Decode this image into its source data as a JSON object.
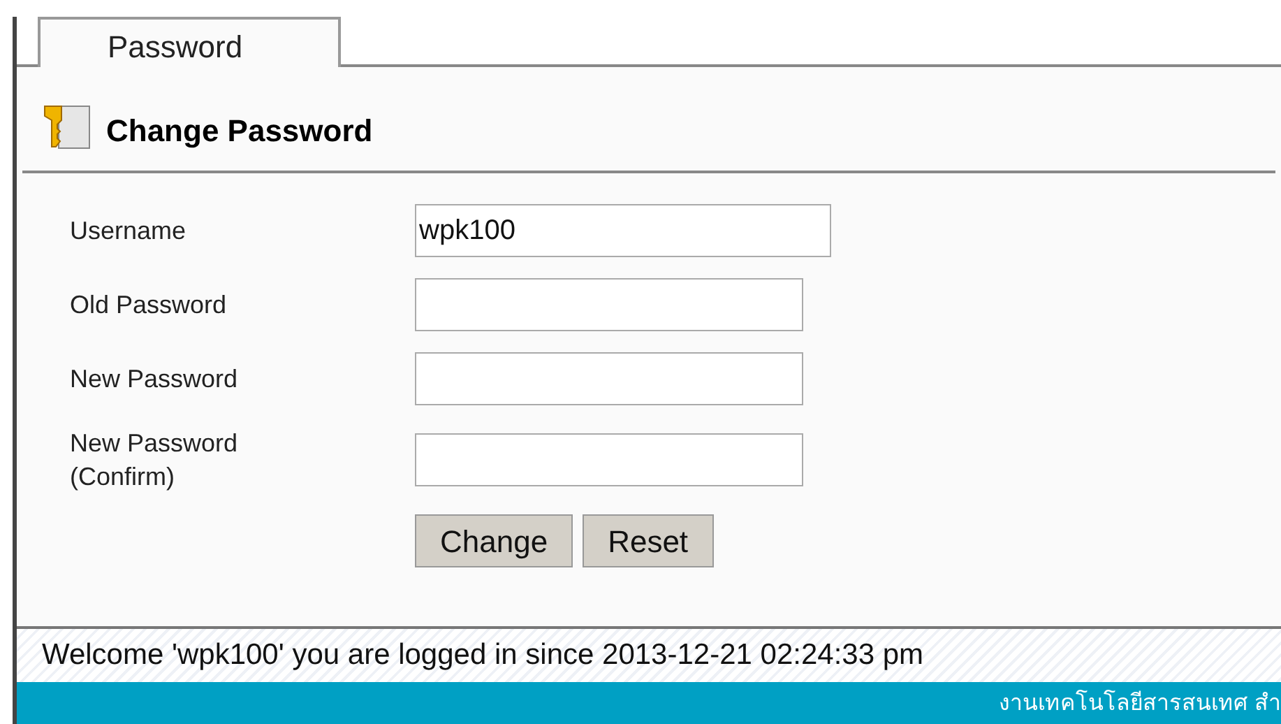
{
  "tabs": [
    {
      "label": "Password",
      "selected": true
    }
  ],
  "heading": "Change Password",
  "form": {
    "fields": [
      {
        "label": "Username",
        "value": "wpk100",
        "wide": true
      },
      {
        "label": "Old Password",
        "wide": false
      },
      {
        "label": "New Password",
        "wide": false
      },
      {
        "label": "New Password (Confirm)",
        "wide": false
      }
    ],
    "buttons": [
      "Change",
      "Reset"
    ]
  },
  "welcome": "Welcome 'wpk100' you are logged in since 2013-12-21 02:24:33 pm",
  "footer": "งานเทคโนโลยีสารสนเทศ สำ"
}
